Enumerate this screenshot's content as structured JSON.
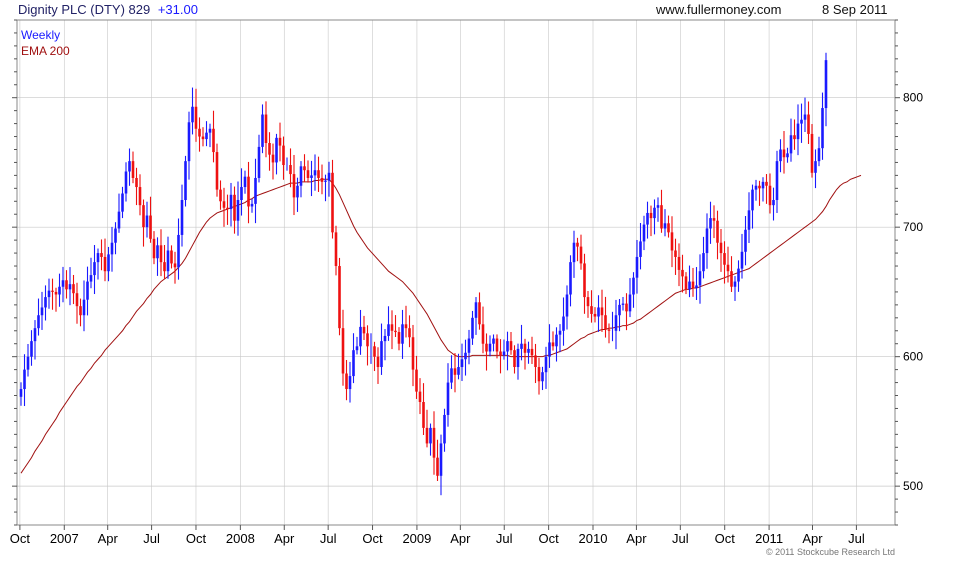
{
  "header": {
    "title": "Dignity PLC (DTY) 829",
    "change": "+31.00",
    "site": "www.fullermoney.com",
    "date": "8 Sep 2011"
  },
  "legend": {
    "weekly": "Weekly",
    "ema": "EMA 200"
  },
  "footer": {
    "copyright": "© 2011 Stockcube Research Ltd"
  },
  "colors": {
    "up": "#1a1aff",
    "down": "#ee1111",
    "ema": "#a01010",
    "grid": "#c8c8c8",
    "title": "#000080",
    "change": "#1a1aff"
  },
  "chart_data": {
    "type": "line",
    "title": "Dignity PLC (DTY) 829 +31.00",
    "xlabel": "",
    "ylabel": "",
    "ylim": [
      470,
      860
    ],
    "yticks": [
      500,
      600,
      700,
      800
    ],
    "x_ticks": [
      "Oct",
      "2007",
      "Apr",
      "Jul",
      "Oct",
      "2008",
      "Apr",
      "Jul",
      "Oct",
      "2009",
      "Apr",
      "Jul",
      "Oct",
      "2010",
      "Apr",
      "Jul",
      "Oct",
      "2011",
      "Apr",
      "Jul"
    ],
    "x_range": [
      "2006-09-25",
      "2011-09-19"
    ],
    "grid": true,
    "legend_position": "top-left",
    "series": [
      {
        "name": "Weekly",
        "style": "OHLC bars (blue up, red down)",
        "x_start": "2006-09-25",
        "interval": "weekly",
        "close": [
          575,
          590,
          600,
          612,
          622,
          632,
          638,
          646,
          651,
          650,
          648,
          654,
          659,
          652,
          656,
          649,
          639,
          632,
          644,
          658,
          663,
          673,
          680,
          677,
          666,
          679,
          688,
          699,
          712,
          726,
          743,
          751,
          738,
          731,
          717,
          700,
          709,
          691,
          676,
          686,
          673,
          666,
          682,
          672,
          669,
          694,
          721,
          751,
          781,
          793,
          776,
          770,
          768,
          773,
          776,
          758,
          729,
          720,
          715,
          714,
          725,
          705,
          721,
          731,
          739,
          716,
          718,
          738,
          762,
          787,
          765,
          756,
          750,
          769,
          763,
          748,
          748,
          741,
          723,
          732,
          747,
          744,
          738,
          740,
          744,
          738,
          735,
          736,
          742,
          696,
          670,
          622,
          587,
          575,
          585,
          605,
          608,
          623,
          618,
          608,
          608,
          600,
          592,
          612,
          616,
          625,
          620,
          619,
          610,
          625,
          622,
          615,
          590,
          573,
          565,
          545,
          533,
          545,
          522,
          508,
          533,
          555,
          580,
          591,
          586,
          592,
          598,
          603,
          614,
          630,
          642,
          625,
          610,
          604,
          610,
          614,
          604,
          601,
          604,
          612,
          605,
          592,
          606,
          610,
          603,
          606,
          601,
          592,
          581,
          588,
          600,
          611,
          608,
          617,
          620,
          631,
          648,
          673,
          688,
          685,
          672,
          646,
          639,
          633,
          631,
          638,
          632,
          621,
          620,
          620,
          632,
          640,
          641,
          635,
          648,
          661,
          677,
          689,
          702,
          711,
          707,
          715,
          717,
          699,
          703,
          696,
          682,
          677,
          667,
          662,
          652,
          658,
          653,
          655,
          666,
          680,
          699,
          707,
          705,
          688,
          680,
          671,
          666,
          654,
          658,
          668,
          681,
          698,
          713,
          729,
          732,
          730,
          735,
          732,
          717,
          721,
          751,
          760,
          754,
          757,
          771,
          768,
          780,
          783,
          787,
          772,
          742,
          751,
          761,
          792,
          829
        ]
      },
      {
        "name": "EMA 200",
        "style": "line",
        "x_start": "2006-09-25",
        "interval": "weekly",
        "values": [
          510,
          514,
          518,
          522,
          527,
          531,
          535,
          540,
          544,
          548,
          552,
          557,
          561,
          565,
          569,
          573,
          577,
          580,
          584,
          588,
          591,
          595,
          598,
          601,
          605,
          608,
          611,
          614,
          617,
          620,
          624,
          627,
          631,
          635,
          638,
          641,
          645,
          648,
          652,
          655,
          658,
          660,
          662,
          664,
          666,
          669,
          672,
          676,
          681,
          686,
          691,
          696,
          700,
          704,
          707,
          709,
          711,
          712,
          713,
          714,
          715,
          716,
          717,
          718,
          719,
          721,
          722,
          724,
          725,
          726,
          727,
          728,
          729,
          730,
          731,
          732,
          733,
          734,
          734,
          734,
          735,
          735,
          735,
          735,
          736,
          736,
          737,
          737,
          737,
          734,
          730,
          725,
          719,
          713,
          707,
          701,
          696,
          692,
          688,
          684,
          681,
          678,
          675,
          672,
          669,
          666,
          664,
          662,
          660,
          658,
          655,
          652,
          649,
          645,
          641,
          637,
          633,
          628,
          623,
          618,
          613,
          609,
          605,
          603,
          601,
          600,
          600,
          600,
          600,
          601,
          601,
          601,
          601,
          601,
          601,
          601,
          601,
          601,
          601,
          601,
          600,
          600,
          600,
          600,
          600,
          600,
          600,
          600,
          600,
          600,
          601,
          601,
          602,
          603,
          604,
          605,
          606,
          608,
          610,
          612,
          614,
          615,
          617,
          618,
          619,
          620,
          621,
          621,
          622,
          622,
          623,
          623,
          624,
          624,
          625,
          626,
          628,
          629,
          631,
          633,
          635,
          637,
          639,
          641,
          643,
          645,
          647,
          649,
          650,
          651,
          652,
          652,
          653,
          653,
          654,
          655,
          656,
          657,
          658,
          659,
          660,
          661,
          662,
          663,
          664,
          665,
          666,
          667,
          668,
          670,
          672,
          674,
          676,
          678,
          680,
          682,
          684,
          686,
          688,
          690,
          692,
          694,
          696,
          698,
          700,
          702,
          704,
          706,
          709,
          712,
          716,
          721,
          725,
          729,
          732,
          734,
          735,
          737,
          738,
          739,
          740
        ]
      }
    ]
  }
}
